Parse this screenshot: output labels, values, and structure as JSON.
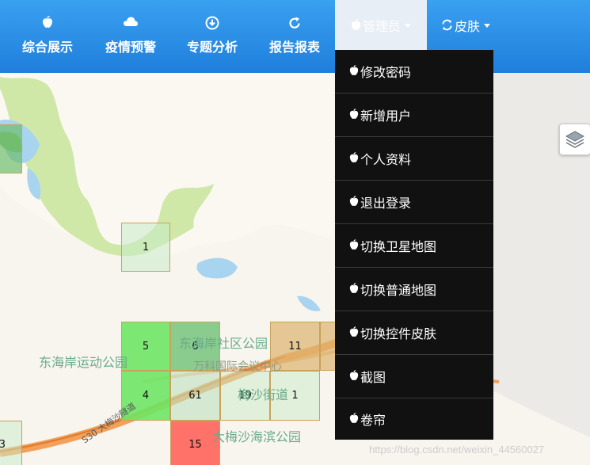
{
  "nav": {
    "items": [
      {
        "label": "综合展示",
        "icon": "apple-icon"
      },
      {
        "label": "疫情预警",
        "icon": "cloud-icon"
      },
      {
        "label": "专题分析",
        "icon": "download-circle-icon"
      },
      {
        "label": "报告报表",
        "icon": "refresh-icon"
      }
    ],
    "admin_label": "管理员",
    "skin_label": "皮肤"
  },
  "dropdown": {
    "items": [
      "修改密码",
      "新增用户",
      "个人资料",
      "退出登录",
      "切换卫星地图",
      "切换普通地图",
      "切换控件皮肤",
      "截图",
      "卷帘"
    ]
  },
  "map": {
    "cells": [
      "1",
      "5",
      "6",
      "11",
      "4",
      "61",
      "19",
      "1",
      "15",
      "3"
    ],
    "pois": [
      "东海岸运动公园",
      "东海岸社区公园",
      "万科国际会议中心",
      "梅沙街道",
      "大梅沙海滨公园"
    ],
    "road_label": "S30 大梅沙隧道"
  },
  "watermark": "https://blog.csdn.net/weixin_44560027",
  "colors": {
    "topbar": "#2a8ee8",
    "dropdown_bg": "#111111",
    "cell_green": "#7fe07a",
    "cell_red": "#ff7a6a",
    "cell_orange": "#e3c08a"
  }
}
